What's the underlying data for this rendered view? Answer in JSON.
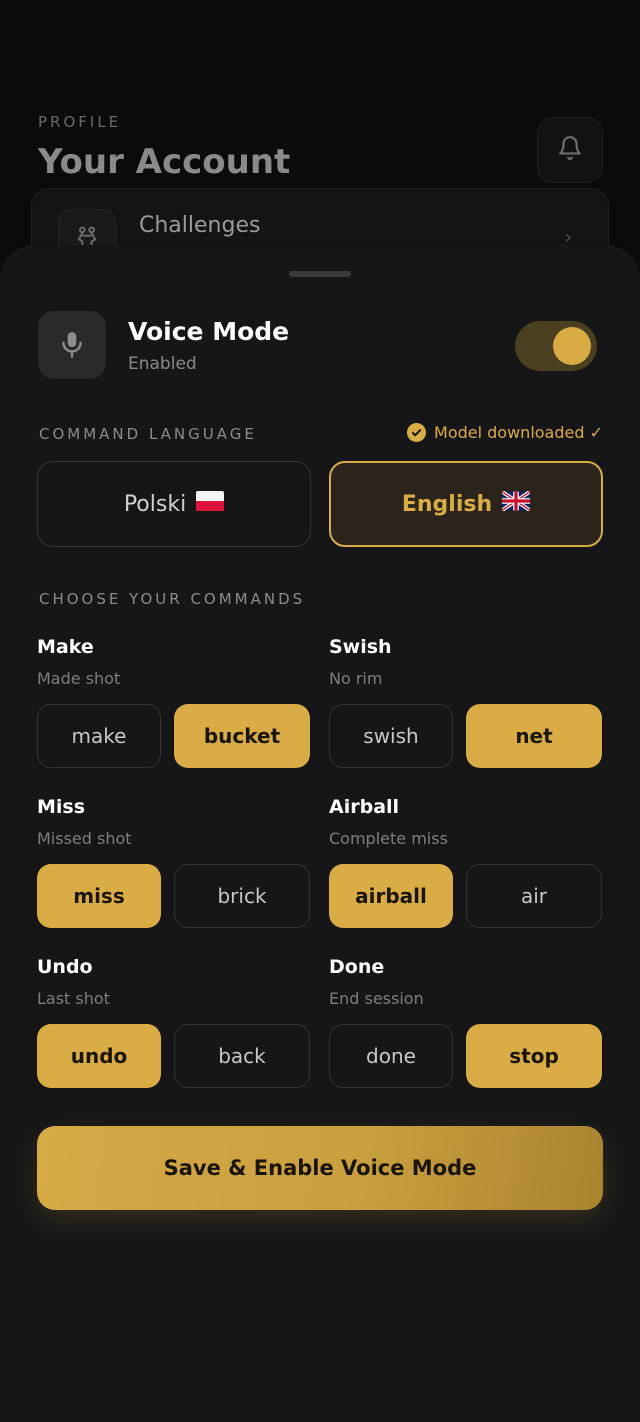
{
  "background_page": {
    "eyebrow": "PROFILE",
    "title": "Your Account",
    "notification_icon": "bell-icon",
    "card": {
      "label": "Challenges",
      "icon": "fighters-icon"
    }
  },
  "voice_mode": {
    "title": "Voice Mode",
    "status": "Enabled",
    "icon": "microphone-icon",
    "enabled": true
  },
  "language": {
    "section_label": "COMMAND LANGUAGE",
    "model_status": "Model downloaded ✓",
    "options": [
      {
        "label": "Polski",
        "flag": "poland-flag",
        "selected": false
      },
      {
        "label": "English",
        "flag": "uk-flag",
        "selected": true
      }
    ]
  },
  "commands": {
    "section_label": "CHOOSE YOUR COMMANDS",
    "groups": [
      {
        "title": "Make",
        "subtitle": "Made shot",
        "options": [
          {
            "label": "make",
            "selected": false
          },
          {
            "label": "bucket",
            "selected": true
          }
        ]
      },
      {
        "title": "Swish",
        "subtitle": "No rim",
        "options": [
          {
            "label": "swish",
            "selected": false
          },
          {
            "label": "net",
            "selected": true
          }
        ]
      },
      {
        "title": "Miss",
        "subtitle": "Missed shot",
        "options": [
          {
            "label": "miss",
            "selected": true
          },
          {
            "label": "brick",
            "selected": false
          }
        ]
      },
      {
        "title": "Airball",
        "subtitle": "Complete miss",
        "options": [
          {
            "label": "airball",
            "selected": true
          },
          {
            "label": "air",
            "selected": false
          }
        ]
      },
      {
        "title": "Undo",
        "subtitle": "Last shot",
        "options": [
          {
            "label": "undo",
            "selected": true
          },
          {
            "label": "back",
            "selected": false
          }
        ]
      },
      {
        "title": "Done",
        "subtitle": "End session",
        "options": [
          {
            "label": "done",
            "selected": false
          },
          {
            "label": "stop",
            "selected": true
          }
        ]
      }
    ]
  },
  "save_button": {
    "label": "Save & Enable Voice Mode"
  },
  "colors": {
    "accent": "#d9ac46",
    "sheet": "#161618",
    "background": "#0b0b0b"
  }
}
